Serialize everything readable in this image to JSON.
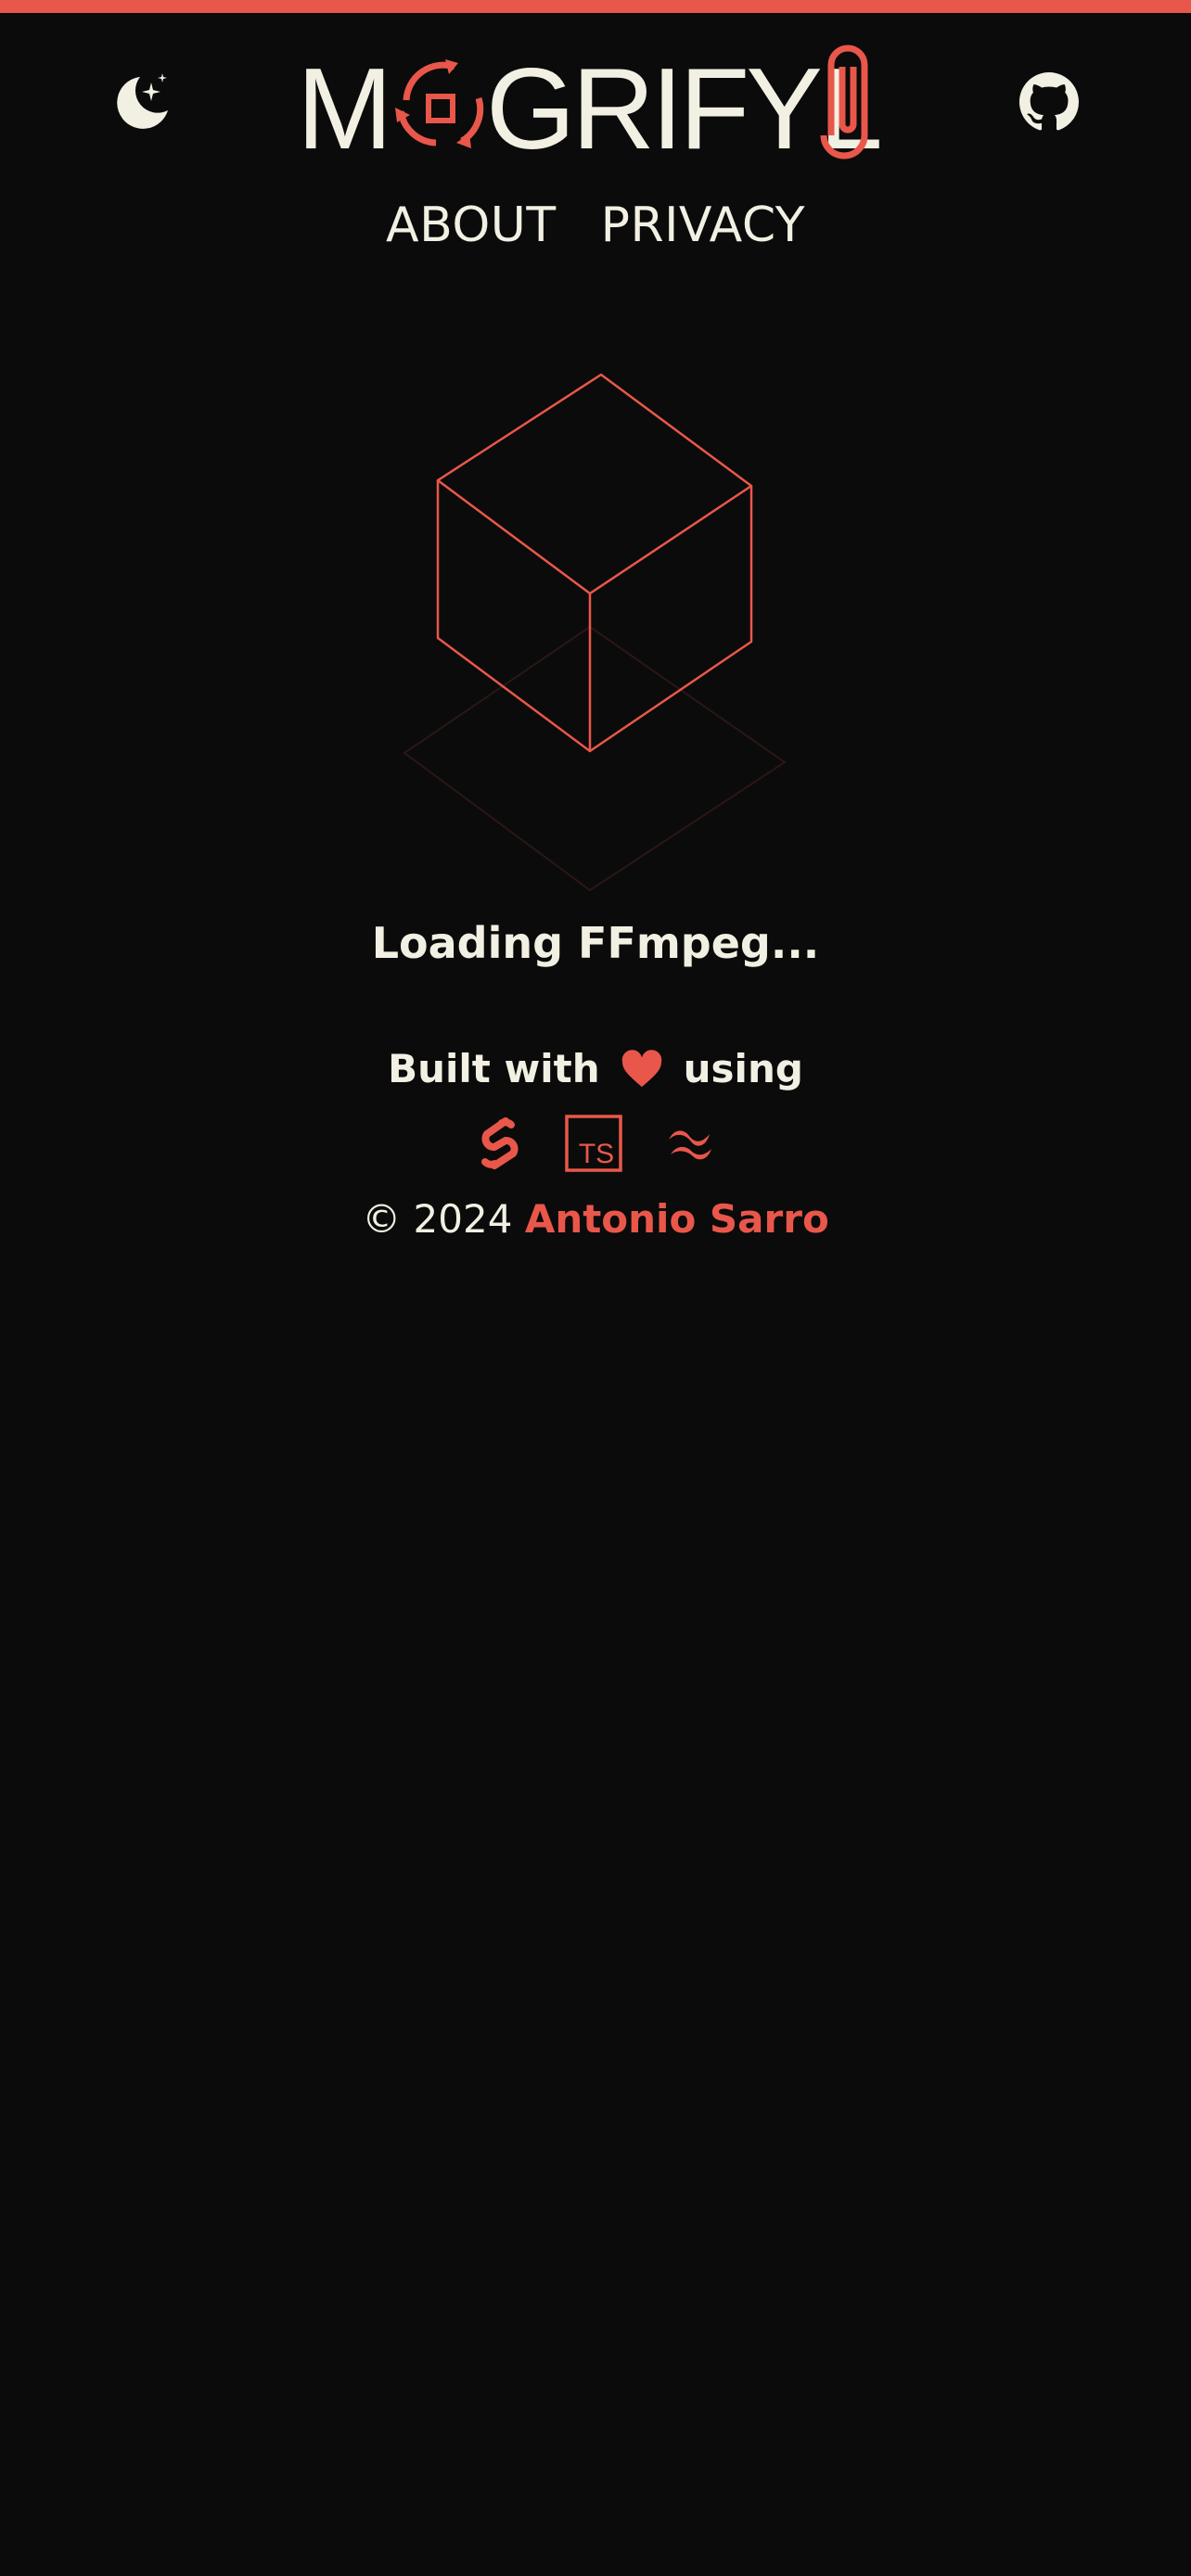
{
  "app": {
    "logo_text": "MOGRIFYLO",
    "accent_color": "#e9574a",
    "background_color": "#0b0b0b",
    "text_color": "#f1f0e3"
  },
  "header": {
    "theme_toggle_icon": "moon-stars-icon",
    "github_icon": "github-icon"
  },
  "nav": {
    "items": [
      {
        "label": "ABOUT"
      },
      {
        "label": "PRIVACY"
      }
    ]
  },
  "main": {
    "loading_text": "Loading FFmpeg..."
  },
  "footer": {
    "built_with_prefix": "Built with",
    "built_with_suffix": "using",
    "heart_icon": "heart-icon",
    "tech_icons": [
      "svelte-icon",
      "typescript-icon",
      "tailwind-icon"
    ],
    "typescript_label": "TS",
    "copyright_prefix": "© 2024",
    "author": "Antonio Sarro"
  }
}
